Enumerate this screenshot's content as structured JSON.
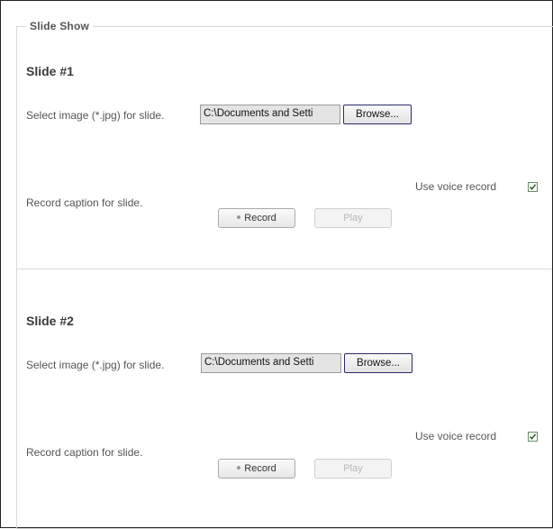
{
  "section": {
    "legend": "Slide Show"
  },
  "slides": [
    {
      "title": "Slide #1",
      "image_label": "Select image (*.jpg) for slide.",
      "file_value": "C:\\Documents and Setti",
      "browse_label": "Browse...",
      "voice_label": "Use voice record",
      "voice_checked": true,
      "caption_label": "Record caption for slide.",
      "record_label": "Record",
      "play_label": "Play"
    },
    {
      "title": "Slide #2",
      "image_label": "Select image (*.jpg) for slide.",
      "file_value": "C:\\Documents and Setti",
      "browse_label": "Browse...",
      "voice_label": "Use voice record",
      "voice_checked": true,
      "caption_label": "Record caption for slide.",
      "record_label": "Record",
      "play_label": "Play"
    }
  ]
}
